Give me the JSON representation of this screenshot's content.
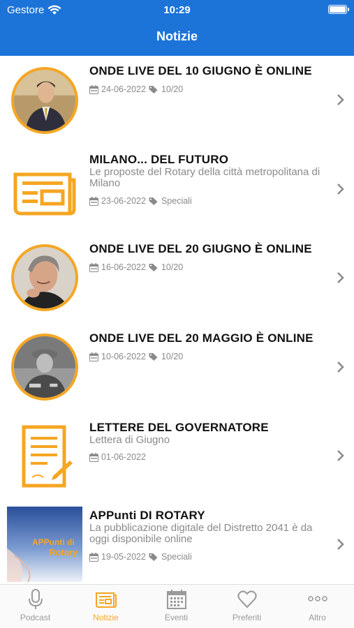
{
  "status_bar": {
    "carrier": "Gestore",
    "time": "10:29"
  },
  "nav": {
    "title": "Notizie"
  },
  "news": [
    {
      "title": "ONDE LIVE DEL 10 GIUGNO È ONLINE",
      "subtitle": "",
      "date": "24-06-2022",
      "tag": "10/20",
      "thumb": "photo-man-suit"
    },
    {
      "title": "MILANO... DEL FUTURO",
      "subtitle": "Le proposte del Rotary della città metropolitana di Milano",
      "date": "23-06-2022",
      "tag": "Speciali",
      "thumb": "newspaper-icon"
    },
    {
      "title": "ONDE LIVE DEL 20 GIUGNO È ONLINE",
      "subtitle": "",
      "date": "16-06-2022",
      "tag": "10/20",
      "thumb": "photo-man-gray"
    },
    {
      "title": "ONDE LIVE DEL 20 MAGGIO È ONLINE",
      "subtitle": "",
      "date": "10-06-2022",
      "tag": "10/20",
      "thumb": "photo-officer"
    },
    {
      "title": "LETTERE DEL GOVERNATORE",
      "subtitle": "Lettera di Giugno",
      "date": "01-06-2022",
      "tag": "",
      "thumb": "letter-icon"
    },
    {
      "title": "APPunti DI ROTARY",
      "subtitle": "La pubblicazione digitale del Distretto 2041 è da oggi disponibile online",
      "date": "19-05-2022",
      "tag": "Speciali",
      "thumb": "appunti-cover"
    }
  ],
  "appunti_cover": {
    "line1": "APPunti di",
    "line2": "Rotary"
  },
  "tabs": [
    {
      "label": "Podcast",
      "icon": "microphone-icon",
      "active": false
    },
    {
      "label": "Notizie",
      "icon": "newspaper-icon",
      "active": true
    },
    {
      "label": "Eventi",
      "icon": "calendar-icon",
      "active": false
    },
    {
      "label": "Preferiti",
      "icon": "heart-icon",
      "active": false
    },
    {
      "label": "Altro",
      "icon": "more-icon",
      "active": false
    }
  ],
  "colors": {
    "header": "#1c74d9",
    "accent": "#f5a623",
    "meta_gray": "#8a8a8a"
  }
}
